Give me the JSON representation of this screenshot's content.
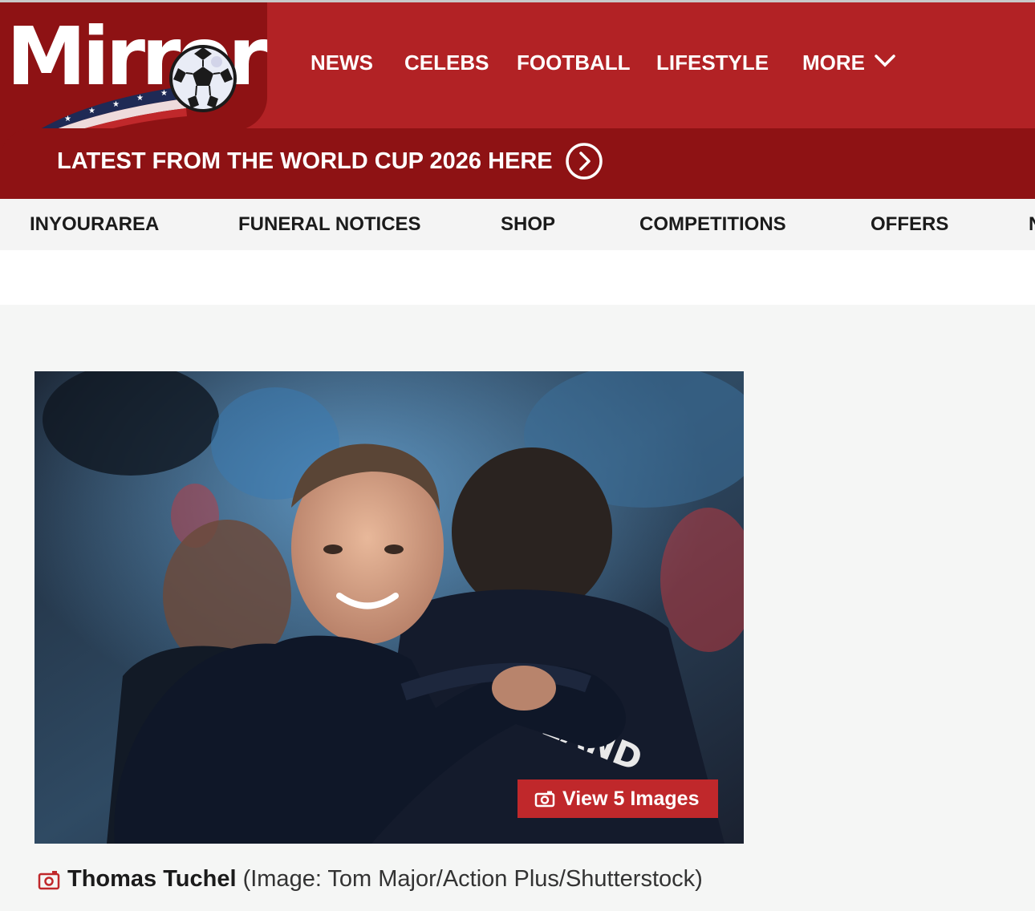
{
  "brand": {
    "name": "Mirror",
    "primary_color": "#b22225",
    "dark_color": "#8e1214"
  },
  "nav": {
    "items": [
      {
        "label": "NEWS"
      },
      {
        "label": "CELEBS"
      },
      {
        "label": "FOOTBALL"
      },
      {
        "label": "LIFESTYLE"
      },
      {
        "label": "MORE"
      }
    ],
    "more_icon": "chevron-down-icon"
  },
  "banner": {
    "text": "LATEST FROM THE WORLD CUP 2026 HERE",
    "icon": "circle-arrow-right-icon"
  },
  "sub_nav": {
    "items": [
      {
        "label": "INYOURAREA"
      },
      {
        "label": "FUNERAL NOTICES"
      },
      {
        "label": "SHOP"
      },
      {
        "label": "COMPETITIONS"
      },
      {
        "label": "OFFERS"
      },
      {
        "label": "N"
      }
    ]
  },
  "article": {
    "gallery_button": "View 5 Images",
    "gallery_icon": "camera-icon",
    "caption_name": "Thomas Tuchel",
    "caption_credit": "(Image: Tom Major/Action Plus/Shutterstock)",
    "accent_color": "#c0282b"
  }
}
